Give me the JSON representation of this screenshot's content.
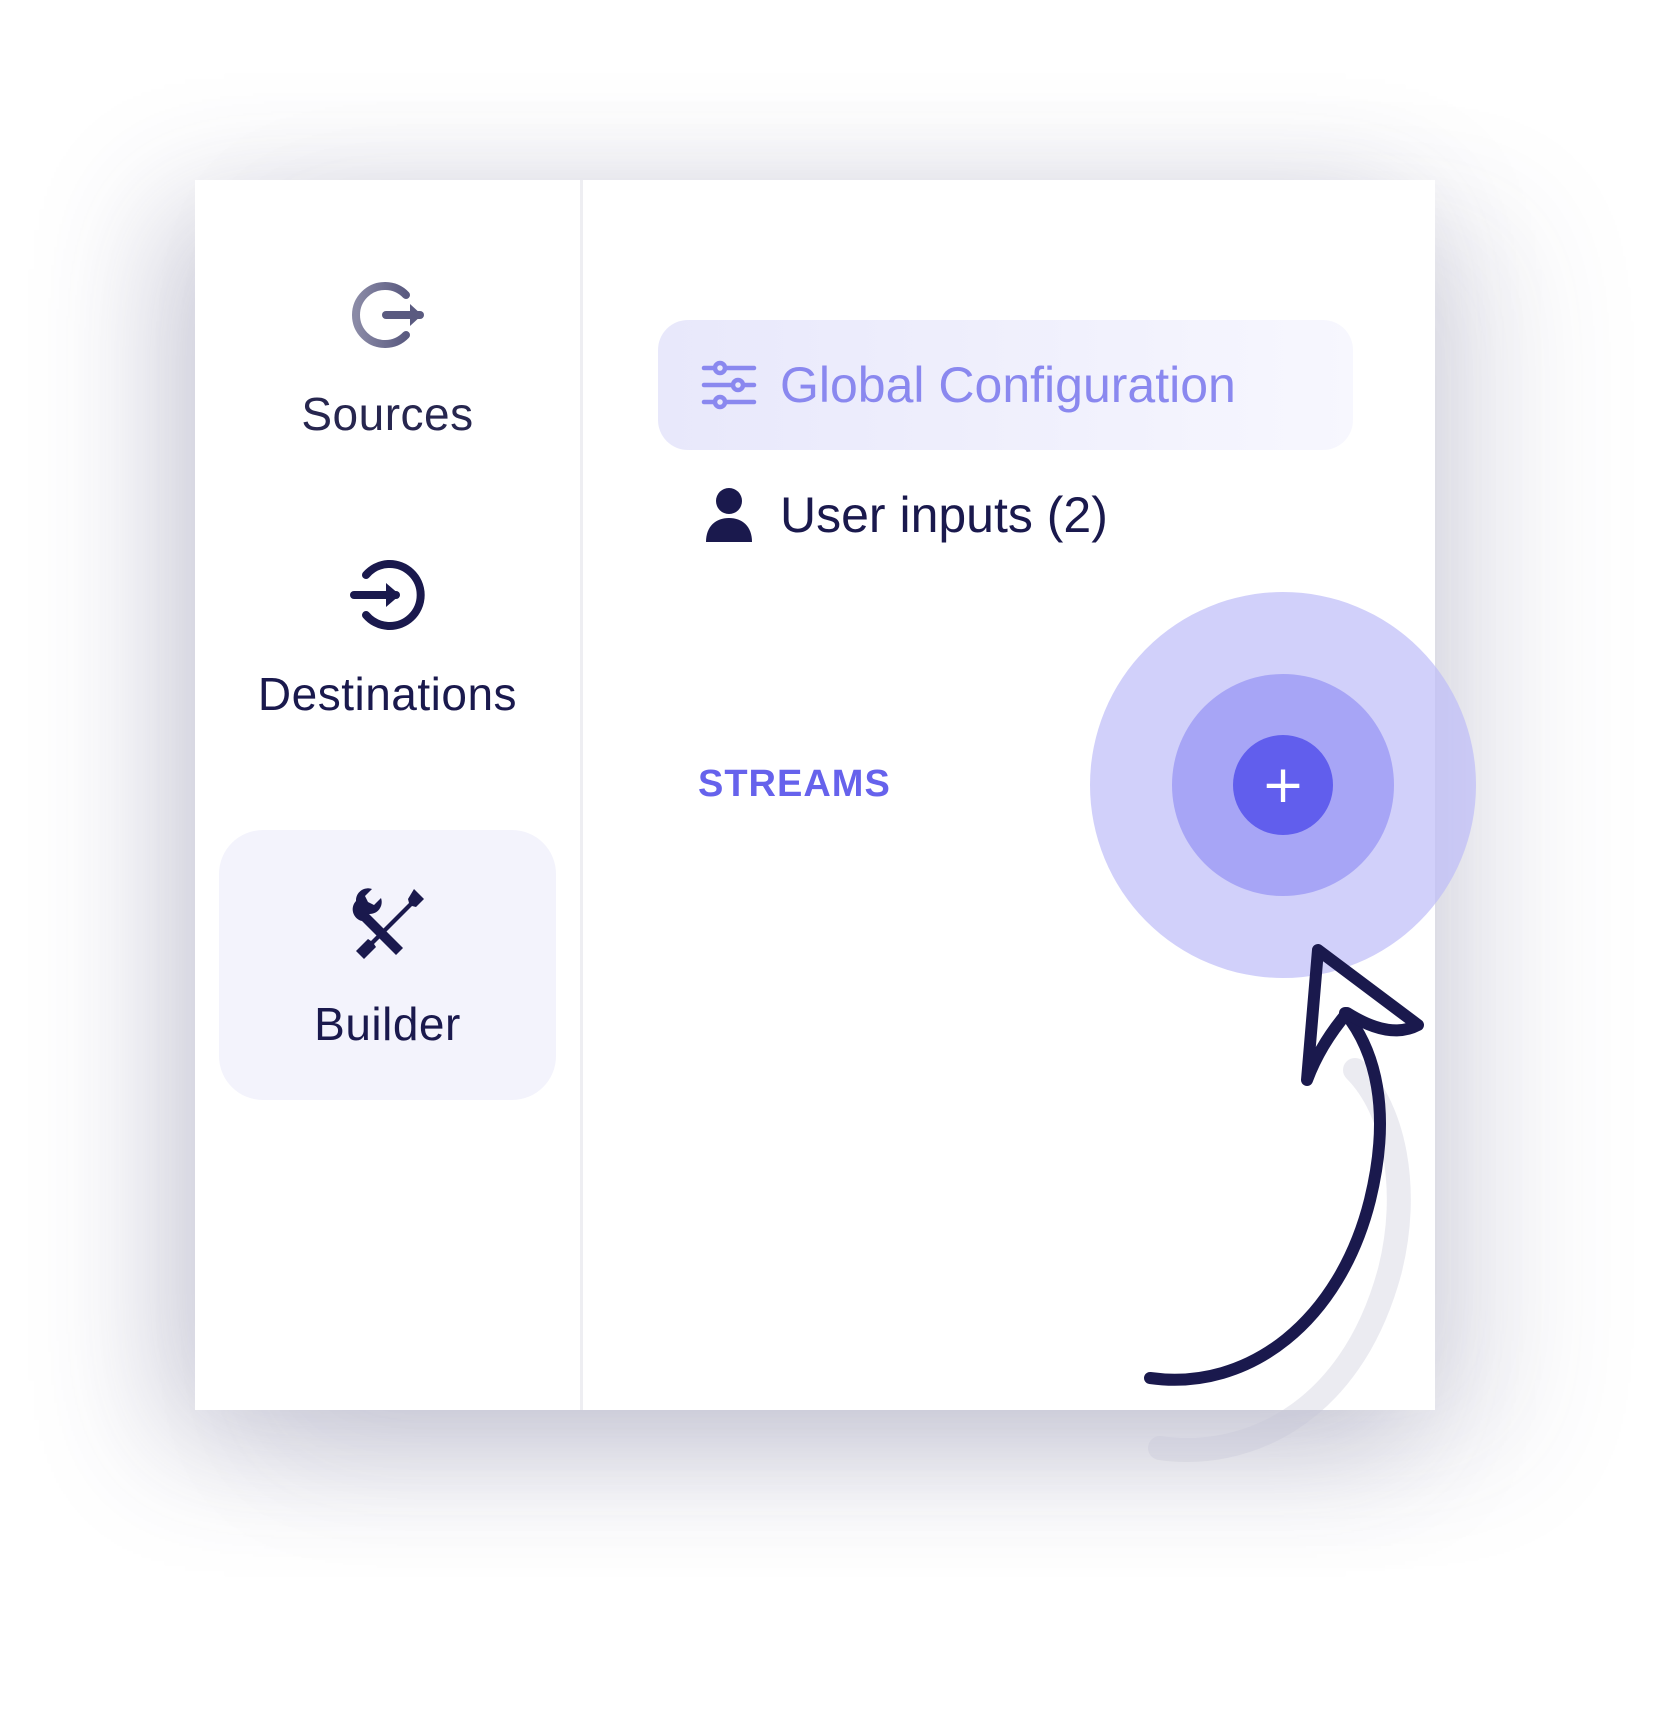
{
  "sidebar": {
    "items": [
      {
        "label": "Sources",
        "icon": "sources-icon",
        "active": false
      },
      {
        "label": "Destinations",
        "icon": "destinations-icon",
        "active": false
      },
      {
        "label": "Builder",
        "icon": "builder-tools-icon",
        "active": true
      }
    ]
  },
  "panel": {
    "menu": [
      {
        "label": "Global Configuration",
        "icon": "sliders-icon",
        "selected": true
      },
      {
        "label": "User inputs (2)",
        "icon": "user-icon",
        "selected": false
      }
    ],
    "section_label": "STREAMS",
    "add_stream_label": "+"
  },
  "colors": {
    "accent": "#615eed",
    "accent_light": "#8a88ef",
    "text": "#1a194d",
    "active_bg": "#f3f3fc",
    "halo": "#bebcf8"
  },
  "annotation": {
    "type": "hand-drawn-arrow",
    "icon": "curved-arrow-icon"
  }
}
